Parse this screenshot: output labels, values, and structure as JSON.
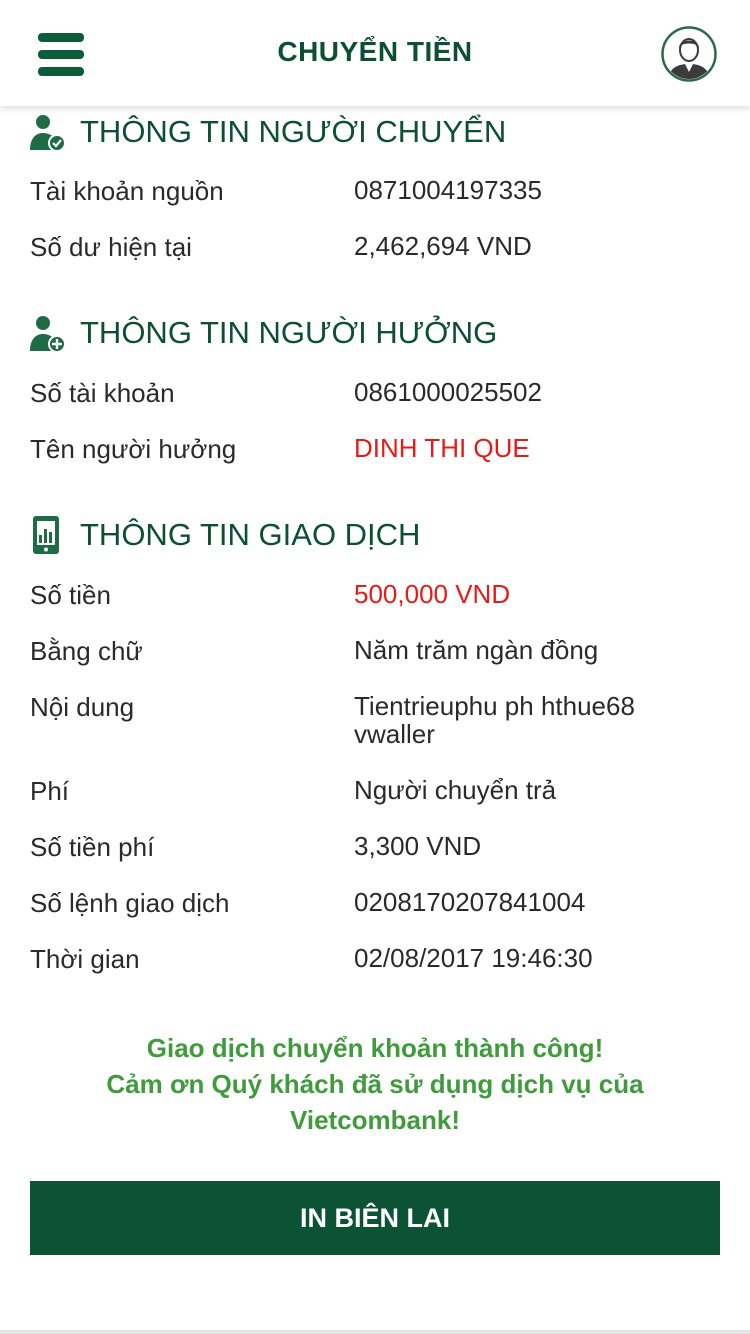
{
  "header": {
    "title": "CHUYỂN TIỀN",
    "menu_icon": "hamburger-menu-icon",
    "avatar_icon": "user-avatar-icon"
  },
  "sender": {
    "title": "THÔNG TIN NGƯỜI CHUYỂN",
    "icon": "user-check-icon",
    "rows": [
      {
        "label": "Tài khoản nguồn",
        "value": "0871004197335"
      },
      {
        "label": "Số dư hiện tại",
        "value": "2,462,694 VND"
      }
    ]
  },
  "beneficiary": {
    "title": "THÔNG TIN NGƯỜI HƯỞNG",
    "icon": "user-add-icon",
    "rows": [
      {
        "label": "Số tài khoản",
        "value": "0861000025502"
      },
      {
        "label": "Tên người hưởng",
        "value": "DINH THI QUE"
      }
    ]
  },
  "transaction": {
    "title": "THÔNG TIN GIAO DỊCH",
    "icon": "receipt-chart-icon",
    "rows": [
      {
        "label": "Số tiền",
        "value": "500,000 VND"
      },
      {
        "label": "Bằng chữ",
        "value": "Năm trăm ngàn đồng"
      },
      {
        "label": "Nội dung",
        "value": "Tientrieuphu ph hthue68 vwaller"
      },
      {
        "label": "Phí",
        "value": "Người chuyển trả"
      },
      {
        "label": "Số tiền phí",
        "value": "3,300 VND"
      },
      {
        "label": "Số lệnh giao dịch",
        "value": "0208170207841004"
      },
      {
        "label": "Thời gian",
        "value": "02/08/2017 19:46:30"
      }
    ]
  },
  "success": {
    "line1": "Giao dịch chuyển khoản thành công!",
    "line2": "Cảm ơn Quý khách đã sử dụng dịch vụ của",
    "line3": "Vietcombank!"
  },
  "print_button": {
    "label": "IN BIÊN LAI"
  },
  "colors": {
    "brand_green": "#0c5234",
    "title_green": "#0c4f31",
    "success_green": "#3f9b3b",
    "highlight_red": "#e41b17"
  }
}
